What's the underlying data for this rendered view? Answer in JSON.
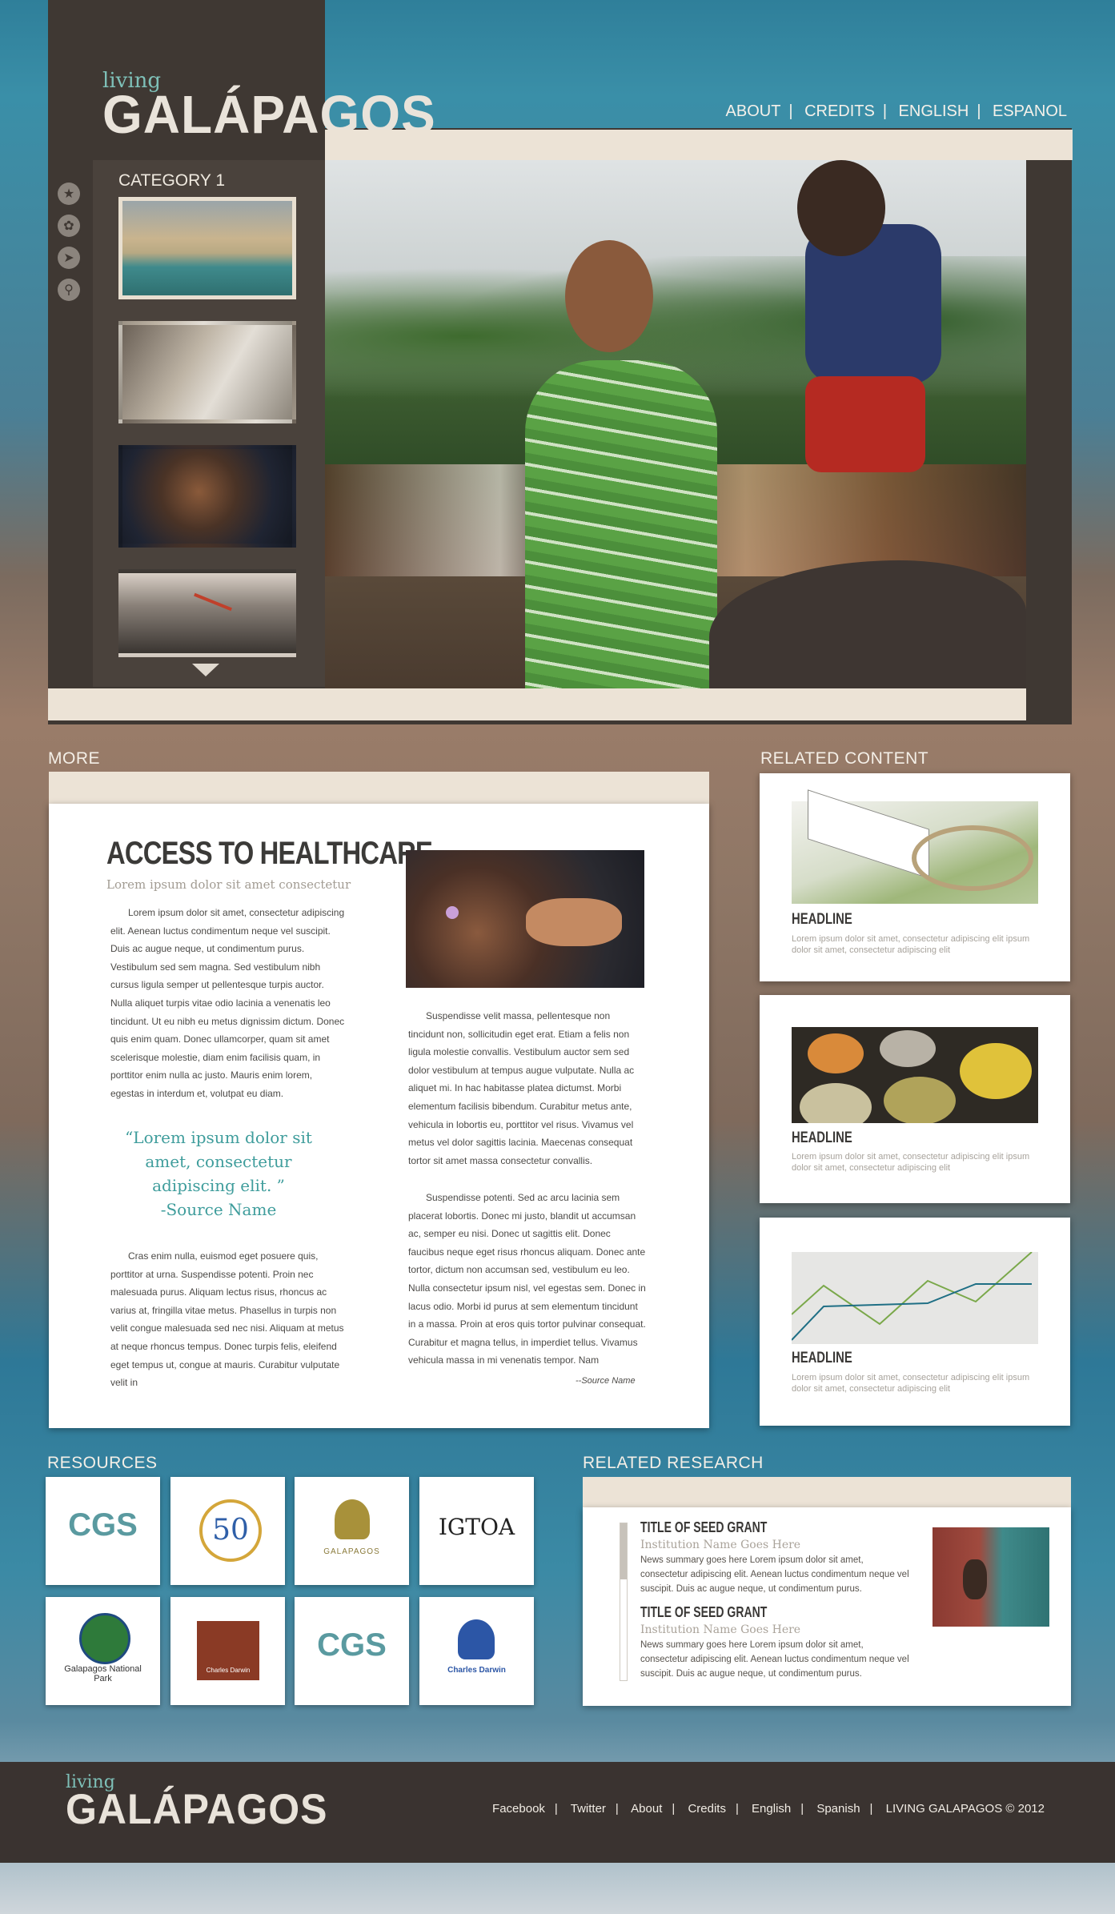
{
  "header": {
    "logo_small": "living",
    "logo_big": "GALÁPAGOS",
    "nav": [
      "ABOUT",
      "CREDITS",
      "ENGLISH",
      "ESPANOL"
    ]
  },
  "gallery": {
    "category_label": "CATEGORY 1",
    "side_icons": [
      "star-icon",
      "turtle-icon",
      "fish-icon",
      "search-icon"
    ],
    "thumbnails": [
      {
        "name": "beach-thumb",
        "active": true
      },
      {
        "name": "hat-man-thumb",
        "active": false
      },
      {
        "name": "woman-necklace-thumb",
        "active": false
      },
      {
        "name": "bird-thumb",
        "active": false
      }
    ]
  },
  "more": {
    "section_label": "MORE",
    "title": "ACCESS TO HEALTHCARE",
    "subtitle": "Lorem ipsum dolor sit amet consectetur",
    "col1_p1": "Lorem ipsum dolor sit amet, consectetur adipiscing elit. Aenean luctus condimentum neque vel suscipit. Duis ac augue neque, ut condimentum purus. Vestibulum sed sem magna. Sed vestibulum nibh cursus ligula semper ut pellentesque turpis auctor. Nulla aliquet turpis vitae odio lacinia a venenatis leo tincidunt. Ut eu nibh eu metus dignissim dictum. Donec quis enim quam. Donec ullamcorper, quam sit amet scelerisque molestie, diam enim facilisis quam, in porttitor enim nulla ac justo. Mauris enim lorem, egestas in interdum et, volutpat eu diam.",
    "quote": "“Lorem ipsum dolor sit amet, consectetur adipiscing elit. ”",
    "quote_source": "-Source Name",
    "col1_p2": "Cras enim nulla, euismod eget posuere quis, porttitor at urna. Suspendisse potenti. Proin nec malesuada purus. Aliquam lectus risus, rhoncus ac varius at, fringilla vitae metus. Phasellus in turpis non velit congue malesuada sed nec nisi. Aliquam at metus at neque rhoncus tempus. Donec turpis felis, eleifend eget tempus ut, congue at mauris. Curabitur vulputate velit in",
    "col2_p1": "Suspendisse velit massa, pellentesque non tincidunt non, sollicitudin eget erat. Etiam a felis non ligula molestie convallis. Vestibulum auctor sem sed dolor vestibulum at tempus augue vulputate. Nulla ac aliquet mi. In hac habitasse platea dictumst. Morbi elementum facilisis bibendum. Curabitur metus ante, vehicula in lobortis eu, porttitor vel risus. Vivamus vel metus vel dolor sagittis lacinia. Maecenas consequat tortor sit amet massa consectetur convallis.",
    "col2_p2": "Suspendisse potenti. Sed ac arcu lacinia sem placerat lobortis. Donec mi justo, blandit ut accumsan ac, semper eu nisi. Donec ut sagittis elit. Donec faucibus neque eget risus rhoncus aliquam. Donec ante tortor, dictum non accumsan sed, vestibulum eu leo. Nulla consectetur ipsum nisl, vel egestas sem. Donec in lacus odio. Morbi id purus at sem elementum tincidunt in a massa. Proin at eros quis tortor pulvinar consequat. Curabitur et magna tellus, in imperdiet tellus. Vivamus vehicula massa in mi venenatis tempor. Nam",
    "col2_source": "--Source Name"
  },
  "related": {
    "section_label": "RELATED CONTENT",
    "cards": [
      {
        "headline": "HEADLINE",
        "text": "Lorem ipsum dolor sit amet, consectetur adipiscing elit ipsum dolor sit amet, consectetur adipiscing elit"
      },
      {
        "headline": "HEADLINE",
        "text": "Lorem ipsum dolor sit amet, consectetur adipiscing elit ipsum dolor sit amet, consectetur adipiscing elit"
      },
      {
        "headline": "HEADLINE",
        "text": "Lorem ipsum dolor sit amet, consectetur adipiscing elit ipsum dolor sit amet, consectetur adipiscing elit"
      }
    ]
  },
  "resources": {
    "section_label": "RESOURCES",
    "logos": [
      {
        "name": "cgs-logo",
        "text": "CGS"
      },
      {
        "name": "50-years-logo",
        "text": "50"
      },
      {
        "name": "galapagos-conservancy-logo",
        "text": "GALAPAGOS"
      },
      {
        "name": "igtoa-logo",
        "text": "IGTOA"
      },
      {
        "name": "galapagos-national-park-logo",
        "text": "Galapagos National Park"
      },
      {
        "name": "charles-darwin-brown-logo",
        "text": "Charles Darwin"
      },
      {
        "name": "cgs-logo-2",
        "text": "CGS"
      },
      {
        "name": "charles-darwin-blue-logo",
        "text": "Charles Darwin"
      }
    ]
  },
  "research": {
    "section_label": "RELATED RESEARCH",
    "items": [
      {
        "title": "TITLE OF SEED GRANT",
        "institution": "Institution Name Goes Here",
        "summary": "News summary goes here Lorem ipsum dolor sit amet, consectetur adipiscing elit. Aenean luctus condimentum neque vel suscipit. Duis ac augue neque, ut condimentum purus."
      },
      {
        "title": "TITLE OF SEED GRANT",
        "institution": "Institution Name Goes Here",
        "summary": "News summary goes here Lorem ipsum dolor sit amet, consectetur adipiscing elit. Aenean luctus condimentum neque vel suscipit. Duis ac augue neque, ut condimentum purus."
      }
    ]
  },
  "footer": {
    "logo_small": "living",
    "logo_big": "GALÁPAGOS",
    "links": [
      "Facebook",
      "Twitter",
      "About",
      "Credits",
      "English",
      "Spanish",
      "LIVING GALAPAGOS © 2012"
    ]
  }
}
